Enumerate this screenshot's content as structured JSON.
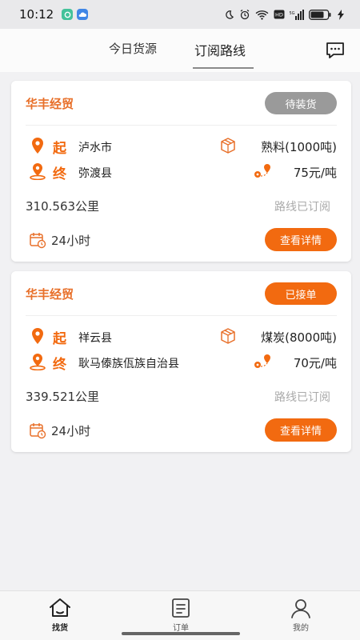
{
  "status_bar": {
    "time": "10:12",
    "battery": "80"
  },
  "tabs": [
    {
      "label": "今日货源"
    },
    {
      "label": "订阅路线"
    }
  ],
  "cards": [
    {
      "company": "华丰经贸",
      "status": "待装货",
      "origin_tag": "起",
      "origin": "泸水市",
      "dest_tag": "终",
      "destination": "弥渡县",
      "goods": "熟料(1000吨)",
      "price": "75元/吨",
      "distance": "310.563公里",
      "subscribed": "路线已订阅",
      "duration": "24小时",
      "detail_label": "查看详情"
    },
    {
      "company": "华丰经贸",
      "status": "已接单",
      "origin_tag": "起",
      "origin": "祥云县",
      "dest_tag": "终",
      "destination": "耿马傣族佤族自治县",
      "goods": "煤炭(8000吨)",
      "price": "70元/吨",
      "distance": "339.521公里",
      "subscribed": "路线已订阅",
      "duration": "24小时",
      "detail_label": "查看详情"
    }
  ],
  "bottom_nav": [
    {
      "label": "找货"
    },
    {
      "label": "订单"
    },
    {
      "label": "我的"
    }
  ],
  "colors": {
    "accent": "#f26a10",
    "company": "#e8702a",
    "badge_gray": "#9a9a9a"
  }
}
